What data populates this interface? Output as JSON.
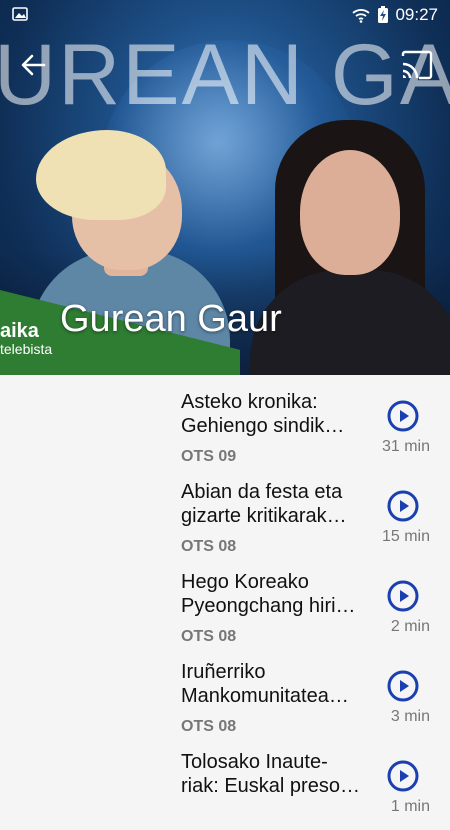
{
  "status_bar": {
    "time": "09:27",
    "icons": [
      "image-notification-icon",
      "wifi-icon",
      "battery-charging-icon"
    ]
  },
  "hero": {
    "background_text": "UREAN GAU",
    "title": "Gurean Gaur",
    "logo_main": "aika",
    "logo_sub": "telebista",
    "colors": {
      "accent_green": "#2e7d32",
      "play_blue": "#1a3fb0"
    }
  },
  "episodes": [
    {
      "title_line1": "Asteko kronika:",
      "title_line2": "Gehiengo sindik…",
      "date": "OTS 09",
      "duration": "31 min"
    },
    {
      "title_line1": "Abian da festa eta",
      "title_line2": "gizarte kritikarak…",
      "date": "OTS 08",
      "duration": "15 min"
    },
    {
      "title_line1": "Hego Koreako",
      "title_line2": "Pyeongchang hiri…",
      "date": "OTS 08",
      "duration": "2 min"
    },
    {
      "title_line1": "Iruñerriko",
      "title_line2": "Mankomunitatea…",
      "date": "OTS 08",
      "duration": "3 min"
    },
    {
      "title_line1": "Tolosako Inaute-",
      "title_line2": "riak: Euskal preso…",
      "date": "",
      "duration": "1 min"
    }
  ]
}
